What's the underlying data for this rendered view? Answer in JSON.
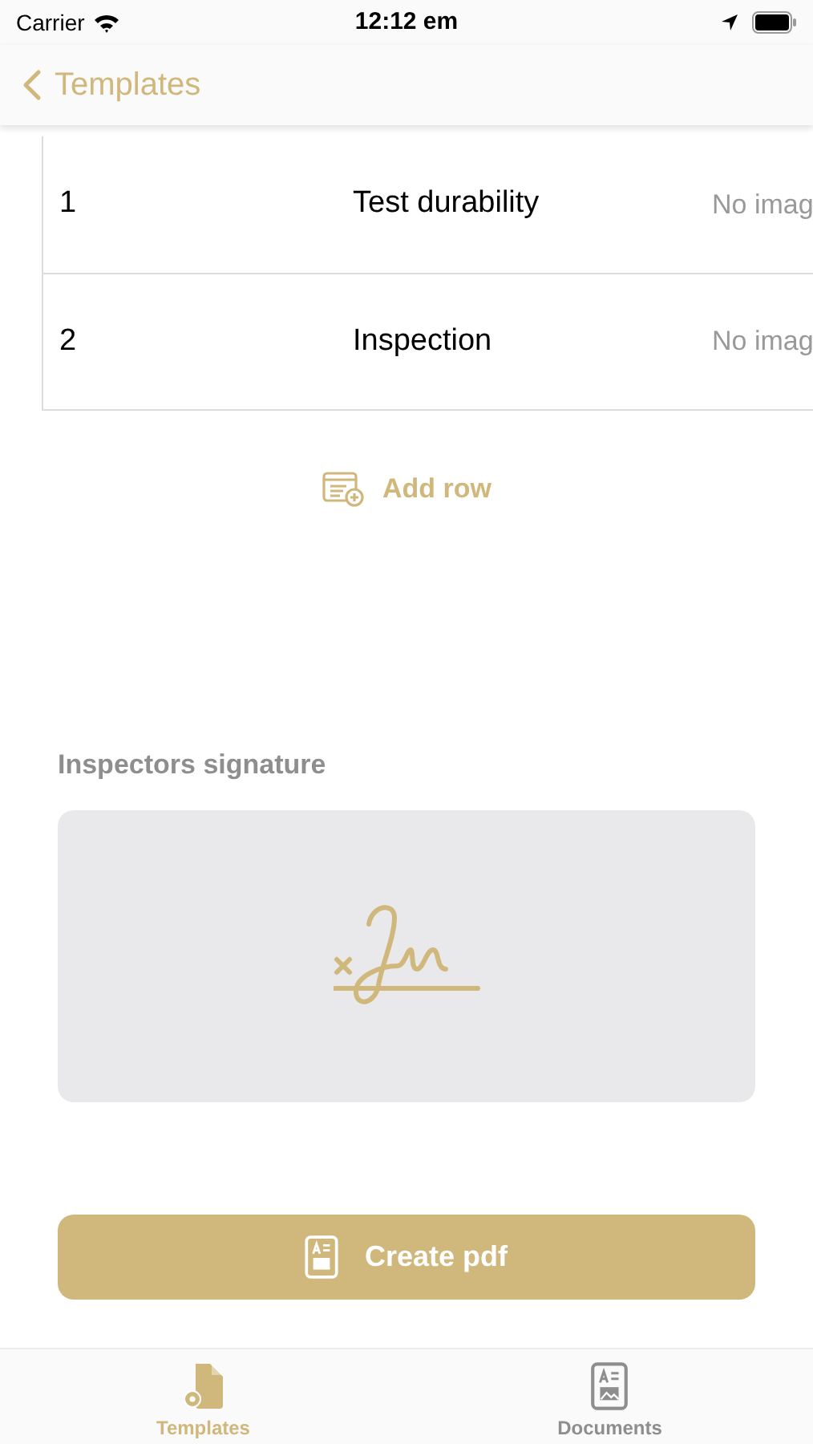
{
  "status_bar": {
    "carrier": "Carrier",
    "time": "12:12 em"
  },
  "nav": {
    "back_label": "Templates"
  },
  "table": {
    "rows": [
      {
        "number": "1",
        "name": "Test durability",
        "image": "No imag"
      },
      {
        "number": "2",
        "name": "Inspection",
        "image": "No imag"
      }
    ]
  },
  "add_row": "Add row",
  "signature": {
    "label": "Inspectors signature"
  },
  "create_button": "Create pdf",
  "tabs": [
    {
      "label": "Templates",
      "kind": "templates",
      "selected": true
    },
    {
      "label": "Documents",
      "kind": "documents",
      "selected": false
    }
  ]
}
